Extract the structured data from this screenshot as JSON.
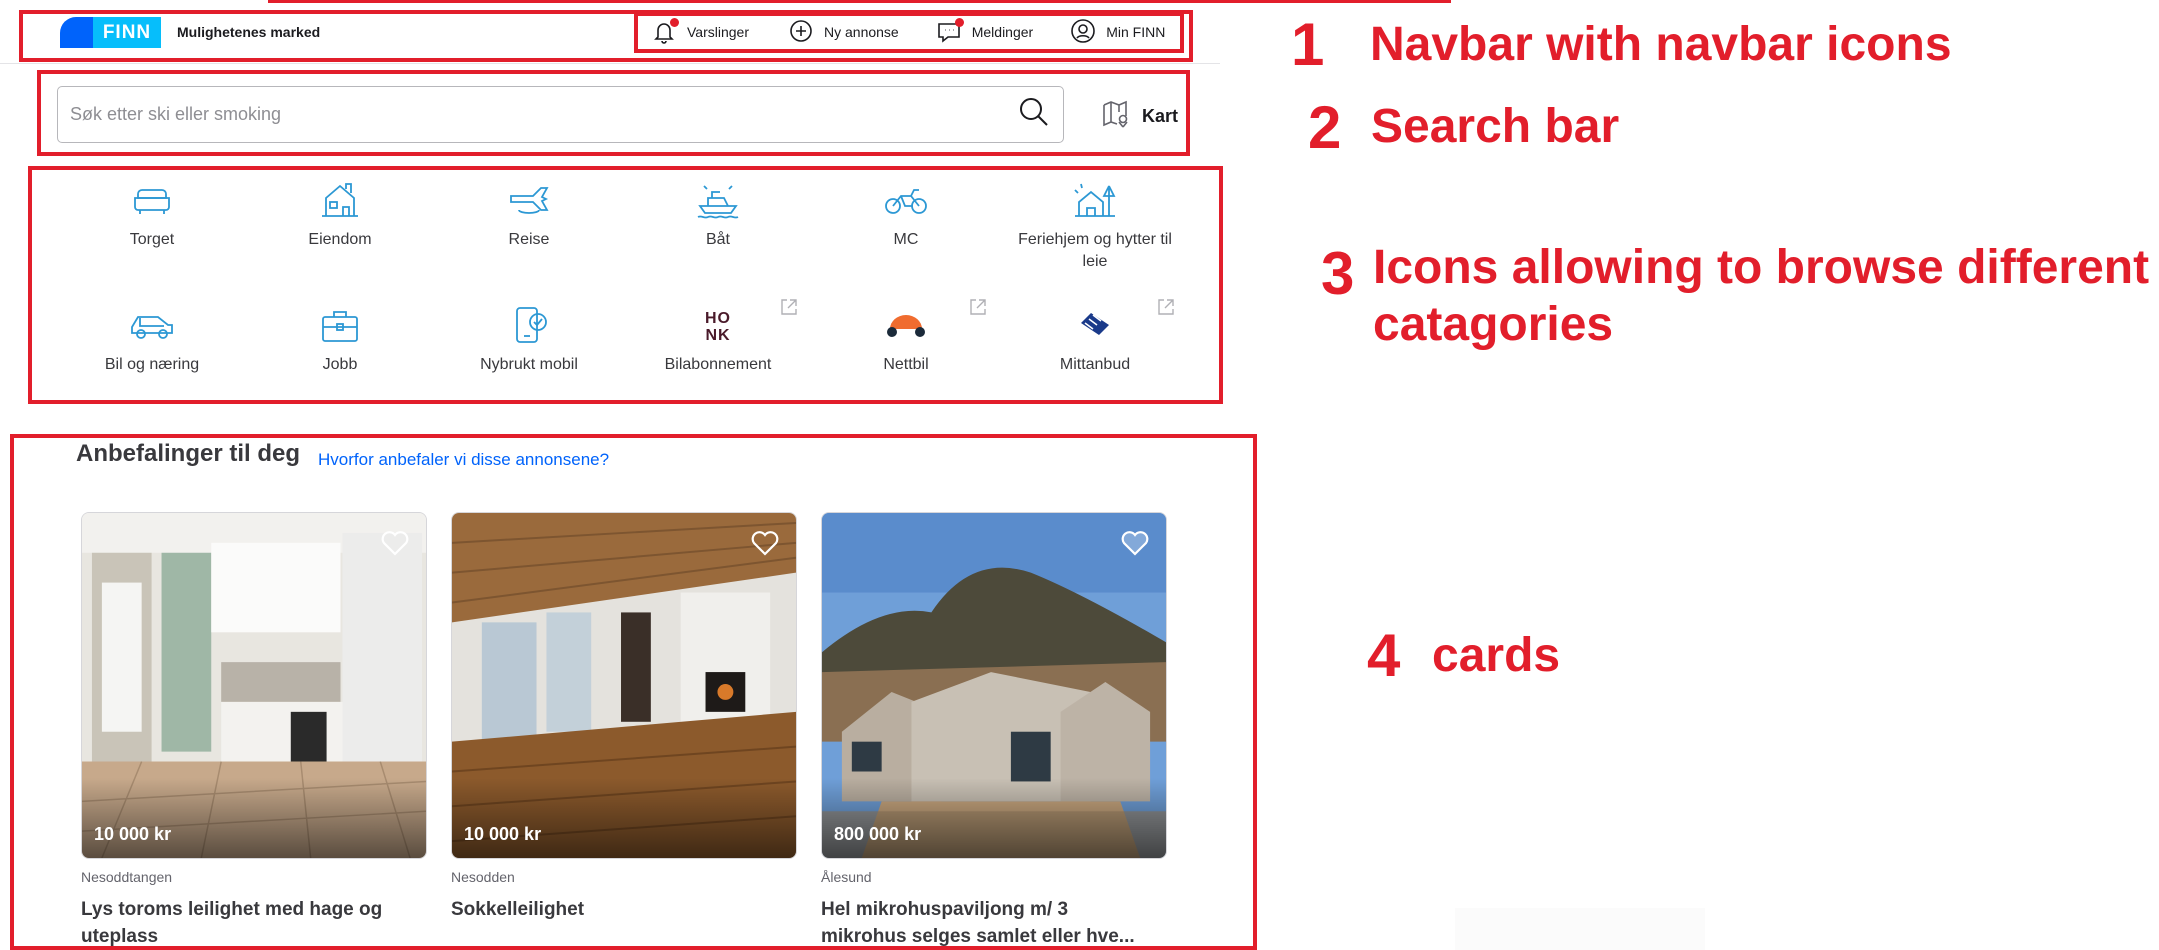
{
  "annotations": [
    {
      "number": "1",
      "label": "Navbar with navbar icons"
    },
    {
      "number": "2",
      "label": "Search bar"
    },
    {
      "number": "3",
      "label": "Icons allowing to browse different catagories"
    },
    {
      "number": "4",
      "label": "cards"
    }
  ],
  "brand": {
    "logo_text": "FINN",
    "tagline": "Mulighetenes marked",
    "colors": {
      "logo_dark": "#0063fb",
      "logo_light": "#06befb",
      "annotation_red": "#e21e2b"
    }
  },
  "navbar": {
    "items": [
      {
        "label": "Varslinger",
        "icon": "bell-icon",
        "notification": true
      },
      {
        "label": "Ny annonse",
        "icon": "plus-circle-icon",
        "notification": false
      },
      {
        "label": "Meldinger",
        "icon": "chat-icon",
        "notification": true
      },
      {
        "label": "Min FINN",
        "icon": "user-circle-icon",
        "notification": false
      }
    ]
  },
  "search": {
    "placeholder": "Søk etter ski eller smoking",
    "value": "",
    "map_label": "Kart"
  },
  "categories": [
    {
      "label": "Torget",
      "icon": "sofa-icon"
    },
    {
      "label": "Eiendom",
      "icon": "house-icon"
    },
    {
      "label": "Reise",
      "icon": "airplane-icon"
    },
    {
      "label": "Båt",
      "icon": "boat-icon"
    },
    {
      "label": "MC",
      "icon": "motorcycle-icon"
    },
    {
      "label": "Feriehjem og hytter til leie",
      "icon": "cabin-icon"
    },
    {
      "label": "Bil og næring",
      "icon": "car-icon"
    },
    {
      "label": "Jobb",
      "icon": "briefcase-icon"
    },
    {
      "label": "Nybrukt mobil",
      "icon": "mobile-icon"
    },
    {
      "label": "Bilabonnement",
      "icon": "honk-logo",
      "logo_text": "HONK",
      "external": true
    },
    {
      "label": "Nettbil",
      "icon": "nettbil-logo",
      "external": true
    },
    {
      "label": "Mittanbud",
      "icon": "mittanbud-logo",
      "external": true
    }
  ],
  "recommendations": {
    "title": "Anbefalinger til deg",
    "why_link": "Hvorfor anbefaler vi disse annonsene?",
    "cards": [
      {
        "price": "10 000 kr",
        "location": "Nesoddtangen",
        "title": "Lys toroms leilighet med hage og uteplass",
        "title_line1": "Lys toroms leilighet med hage og",
        "title_line2": "uteplass",
        "image": "kitchen-photo"
      },
      {
        "price": "10 000 kr",
        "location": "Nesodden",
        "title": "Sokkelleilighet",
        "title_line1": "Sokkelleilighet",
        "title_line2": "",
        "image": "living-room-photo"
      },
      {
        "price": "800 000 kr",
        "location": "Ålesund",
        "title": "Hel mikrohuspaviljong m/ 3 mikrohus selges samlet eller hve...",
        "title_line1": "Hel mikrohuspaviljong m/ 3",
        "title_line2": "mikrohus selges samlet eller hve...",
        "image": "micro-houses-photo"
      }
    ]
  }
}
